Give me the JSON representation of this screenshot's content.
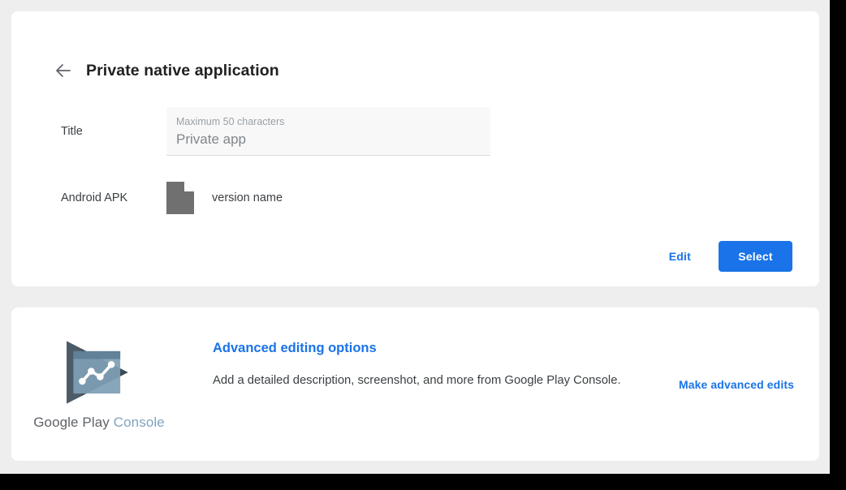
{
  "header": {
    "back_icon": "arrow-left-icon",
    "title": "Private native application"
  },
  "form": {
    "title_row": {
      "label": "Title",
      "hint": "Maximum 50 characters",
      "value": "Private app"
    },
    "apk_row": {
      "label": "Android APK",
      "file_icon": "document-file-icon",
      "version": "version name"
    }
  },
  "actions": {
    "edit_label": "Edit",
    "select_label": "Select"
  },
  "advanced": {
    "logo_icon": "google-play-console-logo",
    "wordmark_primary": "Google Play",
    "wordmark_secondary": "Console",
    "title": "Advanced editing options",
    "description": "Add a detailed description, screenshot, and more from Google Play Console.",
    "link_label": "Make advanced edits"
  },
  "colors": {
    "accent_blue": "#1a73e8",
    "page_background": "#eeeeee",
    "card_background": "#ffffff",
    "text_primary": "#3c4043",
    "text_muted": "#80868b",
    "hint": "#9aa0a6",
    "file_icon_grey": "#707070",
    "logo_dark": "#3d4a55",
    "logo_light": "#7f9fb5",
    "wordmark_secondary": "#80a4c0"
  }
}
